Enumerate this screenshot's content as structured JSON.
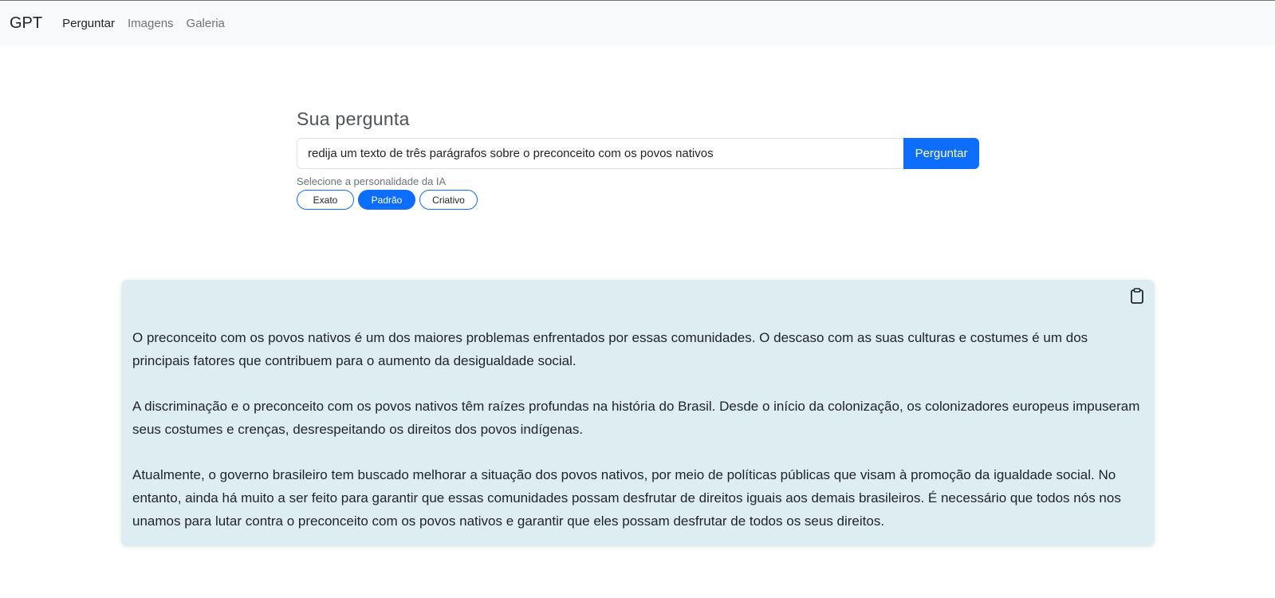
{
  "navbar": {
    "brand": "GPT",
    "links": [
      {
        "label": "Perguntar",
        "active": true
      },
      {
        "label": "Imagens",
        "active": false
      },
      {
        "label": "Galeria",
        "active": false
      }
    ]
  },
  "question": {
    "title": "Sua pergunta",
    "input_value": "redija um texto de três parágrafos sobre o preconceito com os povos nativos",
    "submit_label": "Perguntar",
    "personality_label": "Selecione a personalidade da IA",
    "personality_options": [
      {
        "label": "Exato",
        "selected": false
      },
      {
        "label": "Padrão",
        "selected": true
      },
      {
        "label": "Criativo",
        "selected": false
      }
    ]
  },
  "answer": {
    "copy_icon": "clipboard-icon",
    "paragraphs": [
      "O preconceito com os povos nativos é um dos maiores problemas enfrentados por essas comunidades. O descaso com as suas culturas e costumes é um dos principais fatores que contribuem para o aumento da desigualdade social.",
      "A discriminação e o preconceito com os povos nativos têm raízes profundas na história do Brasil. Desde o início da colonização, os colonizadores europeus impuseram seus costumes e crenças, desrespeitando os direitos dos povos indígenas.",
      "Atualmente, o governo brasileiro tem buscado melhorar a situação dos povos nativos, por meio de políticas públicas que visam à promoção da igualdade social. No entanto, ainda há muito a ser feito para garantir que essas comunidades possam desfrutar de direitos iguais aos demais brasileiros. É necessário que todos nós nos unamos para lutar contra o preconceito com os povos nativos e garantir que eles possam desfrutar de todos os seus direitos."
    ]
  },
  "colors": {
    "primary": "#0d6efd",
    "navbar_bg": "#f8f9fa",
    "answer_bg": "#ddedf1"
  }
}
